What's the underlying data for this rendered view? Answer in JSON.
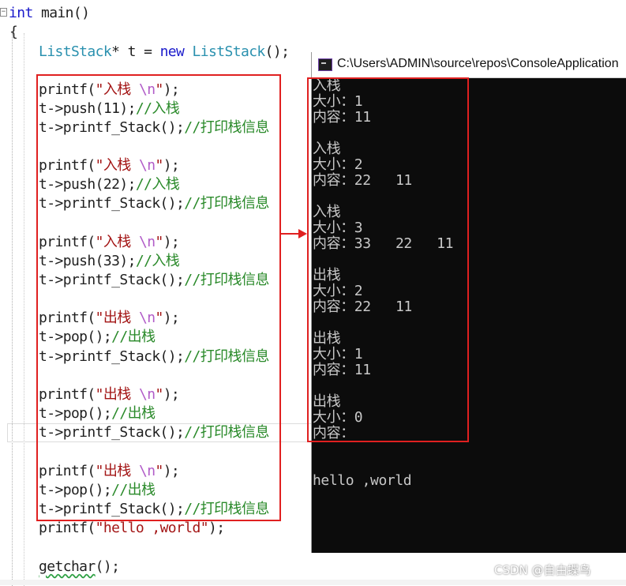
{
  "editor": {
    "collapse_glyph": "−",
    "brace_open": "{",
    "lines": {
      "main_kw": "int",
      "main_rest": " main()",
      "decl_type": "ListStack",
      "decl_mid": "* t = ",
      "decl_new": "new",
      "decl_ctor": "ListStack",
      "decl_end": "();",
      "push1_printf_a": "printf(",
      "push1_str": "\"入栈 ",
      "push1_esc": "\\n",
      "push1_str_end": "\"",
      "push1_printf_b": ");",
      "push1_call": "t->push(11);",
      "push1_cm": "//入栈",
      "print1": "t->printf_Stack();",
      "print1_cm": "//打印栈信息",
      "push2_call": "t->push(22);",
      "push2_cm": "//入栈",
      "print2": "t->printf_Stack();",
      "print2_cm": "//打印栈信息",
      "push3_call": "t->push(33);",
      "push3_cm": "//入栈",
      "print3": "t->printf_Stack();",
      "print3_cm": "//打印栈信息",
      "pop_str": "\"出栈 ",
      "pop1_call": "t->pop();",
      "pop1_cm": "//出栈",
      "print4": "t->printf_Stack();",
      "print4_cm": "//打印栈信息",
      "pop2_call": "t->pop();",
      "pop2_cm": "//出栈",
      "print5": "t->printf_Stack();",
      "print5_cm": "//打印栈信息",
      "pop3_call": "t->pop();",
      "pop3_cm": "//出栈",
      "print6": "t->printf_Stack();",
      "print6_cm": "//打印栈信息",
      "hello_a": "printf(",
      "hello_str": "\"hello ,world\"",
      "hello_b": ");",
      "getchar_fn": "getchar",
      "getchar_end": "();"
    }
  },
  "console": {
    "title": "C:\\Users\\ADMIN\\source\\repos\\ConsoleApplication",
    "output": [
      "入栈",
      "大小：1",
      "内容：11",
      "",
      "入栈",
      "大小：2",
      "内容：22   11",
      "",
      "入栈",
      "大小：3",
      "内容：33   22   11",
      "",
      "出栈",
      "大小：2",
      "内容：22   11",
      "",
      "出栈",
      "大小：1",
      "内容：11",
      "",
      "出栈",
      "大小：0",
      "内容：",
      "",
      "",
      "hello ,world"
    ]
  },
  "watermark": "CSDN @自由蝶鸟",
  "colors": {
    "annotation_red": "#e02020",
    "console_bg": "#0c0c0c",
    "console_fg": "#c8c8c8",
    "keyword": "#1a1acb",
    "type": "#2b91af",
    "string": "#a31515",
    "comment": "#2a8a2a"
  }
}
